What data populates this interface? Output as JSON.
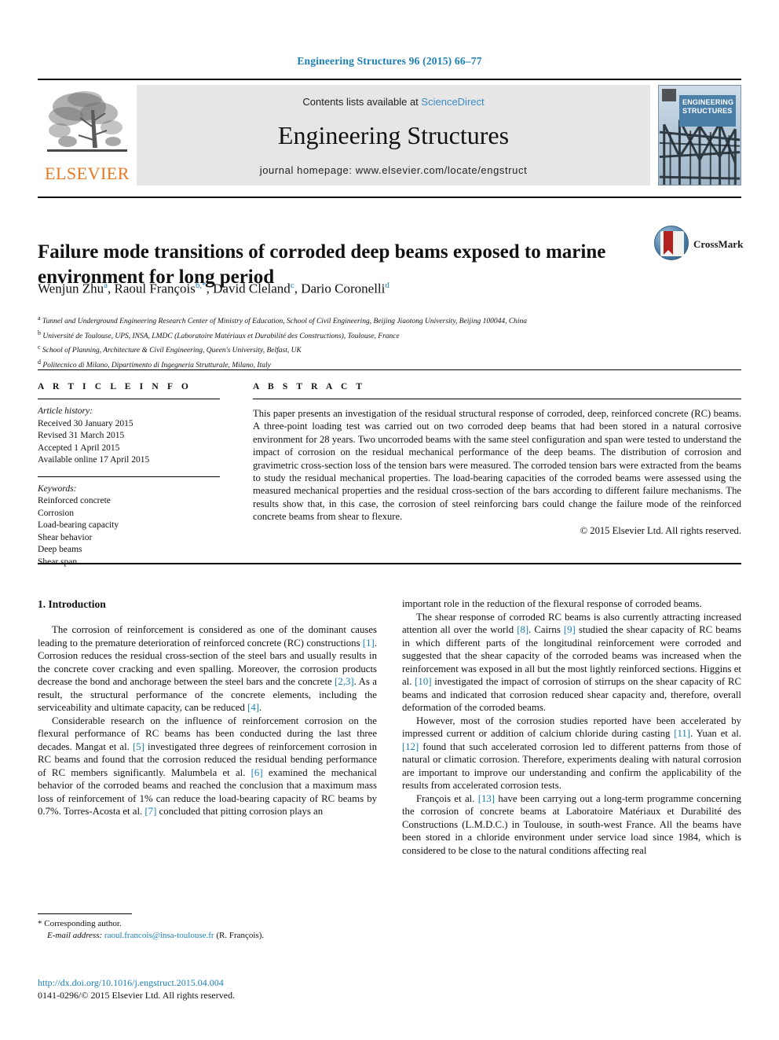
{
  "running_head": "Engineering Structures 96 (2015) 66–77",
  "masthead": {
    "publisher_name": "ELSEVIER",
    "contents_prefix": "Contents lists available at",
    "contents_link": "ScienceDirect",
    "journal_title": "Engineering Structures",
    "homepage": "journal homepage: www.elsevier.com/locate/engstruct",
    "cover_title": "Engineering Structures"
  },
  "crossmark": {
    "label": "CrossMark"
  },
  "article": {
    "title": "Failure mode transitions of corroded deep beams exposed to marine environment for long period",
    "authors": [
      {
        "name": "Wenjun Zhu",
        "marks": "a"
      },
      {
        "name": "Raoul François",
        "marks": "b,*"
      },
      {
        "name": "David Cleland",
        "marks": "c"
      },
      {
        "name": "Dario Coronelli",
        "marks": "d"
      }
    ],
    "affiliations": [
      {
        "mark": "a",
        "text": "Tunnel and Underground Engineering Research Center of Ministry of Education, School of Civil Engineering, Beijing Jiaotong University, Beijing 100044, China"
      },
      {
        "mark": "b",
        "text": "Université de Toulouse, UPS, INSA, LMDC (Laboratoire Matériaux et Durabilité des Constructions), Toulouse, France"
      },
      {
        "mark": "c",
        "text": "School of Planning, Architecture & Civil Engineering, Queen's University, Belfast, UK"
      },
      {
        "mark": "d",
        "text": "Politecnico di Milano, Dipartimento di Ingegneria Strutturale, Milano, Italy"
      }
    ]
  },
  "article_info": {
    "heading": "A R T I C L E   I N F O",
    "history_label": "Article history:",
    "history": [
      "Received 30 January 2015",
      "Revised 31 March 2015",
      "Accepted 1 April 2015",
      "Available online 17 April 2015"
    ],
    "keywords_label": "Keywords:",
    "keywords": [
      "Reinforced concrete",
      "Corrosion",
      "Load-bearing capacity",
      "Shear behavior",
      "Deep beams",
      "Shear span"
    ]
  },
  "abstract": {
    "heading": "A B S T R A C T",
    "text": "This paper presents an investigation of the residual structural response of corroded, deep, reinforced concrete (RC) beams. A three-point loading test was carried out on two corroded deep beams that had been stored in a natural corrosive environment for 28 years. Two uncorroded beams with the same steel configuration and span were tested to understand the impact of corrosion on the residual mechanical performance of the deep beams. The distribution of corrosion and gravimetric cross-section loss of the tension bars were measured. The corroded tension bars were extracted from the beams to study the residual mechanical properties. The load-bearing capacities of the corroded beams were assessed using the measured mechanical properties and the residual cross-section of the bars according to different failure mechanisms. The results show that, in this case, the corrosion of steel reinforcing bars could change the failure mode of the reinforced concrete beams from shear to flexure.",
    "copyright": "© 2015 Elsevier Ltd. All rights reserved."
  },
  "introduction": {
    "heading": "1. Introduction",
    "left_paragraphs": [
      "The corrosion of reinforcement is considered as one of the dominant causes leading to the premature deterioration of reinforced concrete (RC) constructions [1]. Corrosion reduces the residual cross-section of the steel bars and usually results in the concrete cover cracking and even spalling. Moreover, the corrosion products decrease the bond and anchorage between the steel bars and the concrete [2,3]. As a result, the structural performance of the concrete elements, including the serviceability and ultimate capacity, can be reduced [4].",
      "Considerable research on the influence of reinforcement corrosion on the flexural performance of RC beams has been conducted during the last three decades. Mangat et al. [5] investigated three degrees of reinforcement corrosion in RC beams and found that the corrosion reduced the residual bending performance of RC members significantly. Malumbela et al. [6] examined the mechanical behavior of the corroded beams and reached the conclusion that a maximum mass loss of reinforcement of 1% can reduce the load-bearing capacity of RC beams by 0.7%. Torres-Acosta et al. [7] concluded that pitting corrosion plays an"
    ],
    "right_paragraphs": [
      "important role in the reduction of the flexural response of corroded beams.",
      "The shear response of corroded RC beams is also currently attracting increased attention all over the world [8]. Cairns [9] studied the shear capacity of RC beams in which different parts of the longitudinal reinforcement were corroded and suggested that the shear capacity of the corroded beams was increased when the reinforcement was exposed in all but the most lightly reinforced sections. Higgins et al. [10] investigated the impact of corrosion of stirrups on the shear capacity of RC beams and indicated that corrosion reduced shear capacity and, therefore, overall deformation of the corroded beams.",
      "However, most of the corrosion studies reported have been accelerated by impressed current or addition of calcium chloride during casting [11]. Yuan et al. [12] found that such accelerated corrosion led to different patterns from those of natural or climatic corrosion. Therefore, experiments dealing with natural corrosion are important to improve our understanding and confirm the applicability of the results from accelerated corrosion tests.",
      "François et al. [13] have been carrying out a long-term programme concerning the corrosion of concrete beams at Laboratoire Matériaux et Durabilité des Constructions (L.M.D.C.) in Toulouse, in south-west France. All the beams have been stored in a chloride environment under service load since 1984, which is considered to be close to the natural conditions affecting real"
    ]
  },
  "footnote": {
    "corresponding_marker": "*",
    "corresponding_text": "Corresponding author.",
    "email_label": "E-mail address:",
    "email": "raoul.francois@insa-toulouse.fr",
    "email_suffix": "(R. François)."
  },
  "footer": {
    "doi": "http://dx.doi.org/10.1016/j.engstruct.2015.04.004",
    "issn_line": "0141-0296/© 2015 Elsevier Ltd. All rights reserved."
  },
  "colors": {
    "link_blue": "#1a7fb5",
    "elsevier_orange": "#E87722",
    "masthead_grey": "#e6e6e6"
  }
}
